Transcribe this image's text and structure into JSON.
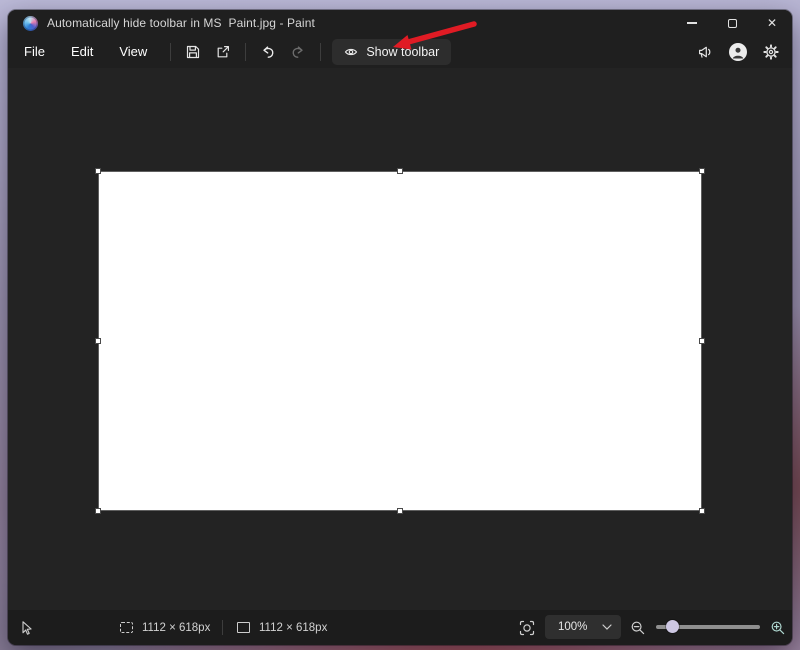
{
  "titlebar": {
    "title": "Automatically hide toolbar in MS  Paint.jpg - Paint"
  },
  "menubar": {
    "items": [
      {
        "label": "File"
      },
      {
        "label": "Edit"
      },
      {
        "label": "View"
      }
    ],
    "show_toolbar": {
      "label": "Show toolbar"
    }
  },
  "statusbar": {
    "selection_size": "1112 × 618px",
    "image_size": "1112 × 618px",
    "zoom": {
      "value": "100%"
    }
  },
  "icons": {
    "titlebar": [
      "paint-logo",
      "minimize-icon",
      "maximize-icon",
      "close-icon"
    ],
    "menubar": [
      "save-icon",
      "share-icon",
      "undo-icon",
      "redo-icon",
      "eye-icon",
      "megaphone-icon",
      "account-icon",
      "gear-icon"
    ],
    "statusbar": [
      "cursor-icon",
      "selection-size-icon",
      "image-size-icon",
      "fit-to-window-icon",
      "chevron-down-icon",
      "zoom-out-icon",
      "zoom-in-icon"
    ]
  },
  "annotation": {
    "arrow_color": "#e01b24",
    "points_to": "Show toolbar"
  },
  "colors": {
    "window_bg": "#1f1f1f",
    "canvas_area_bg": "#232323",
    "statusbar_bg": "#1c1c1c",
    "button_bg": "#2d2d2d",
    "canvas_white": "#ffffff",
    "slider_thumb": "#cdc7e2"
  }
}
